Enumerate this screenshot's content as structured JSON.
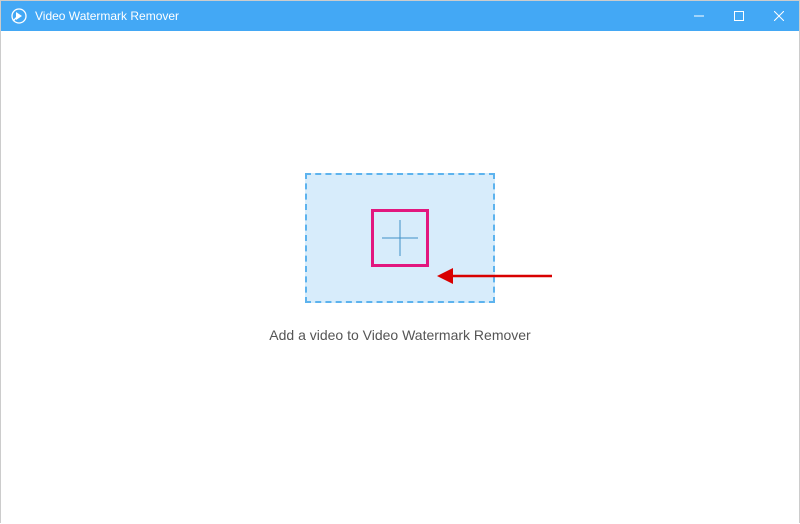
{
  "titlebar": {
    "app_title": "Video Watermark Remover"
  },
  "main": {
    "instruction": "Add a video to Video Watermark Remover"
  }
}
